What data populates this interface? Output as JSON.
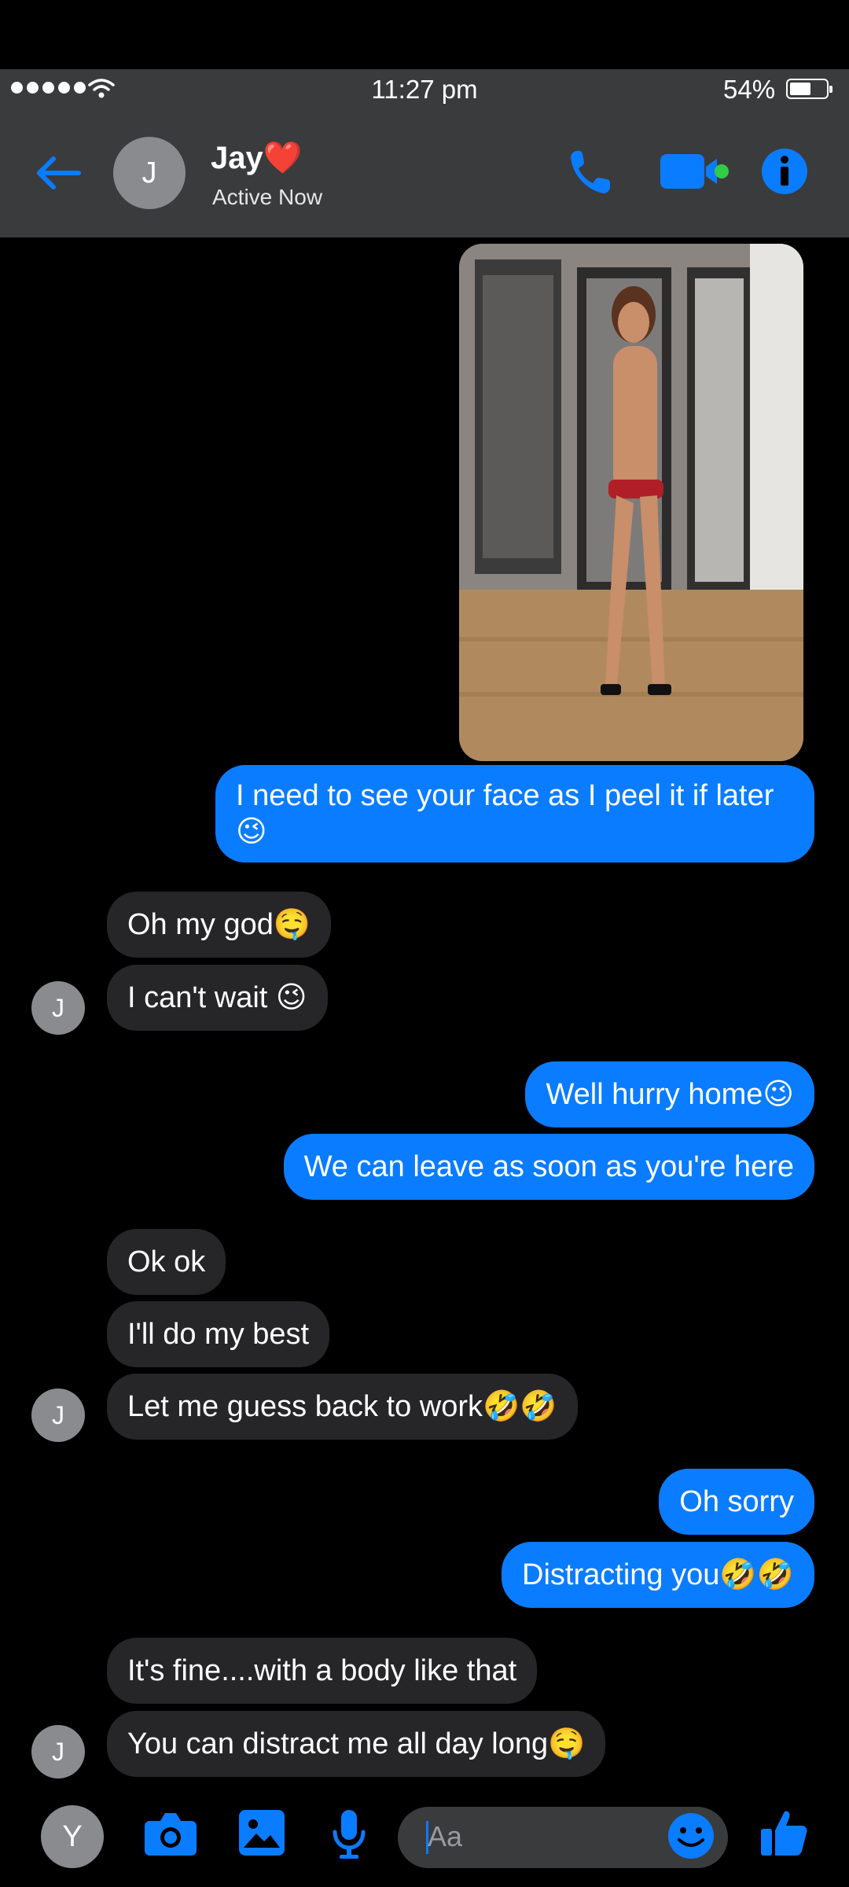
{
  "status_bar": {
    "time": "11:27 pm",
    "battery": "54%"
  },
  "header": {
    "avatar_initial": "J",
    "contact_name": "Jay",
    "contact_heart": "❤️",
    "contact_status": "Active Now"
  },
  "messages": [
    {
      "dir": "out",
      "text": "I need to see your face as I peel it if later",
      "text2": "😉"
    },
    {
      "dir": "in",
      "text": "Oh my god🤤"
    },
    {
      "dir": "in",
      "text": "I can't wait 😉"
    },
    {
      "dir": "out",
      "text": "Well hurry home😉"
    },
    {
      "dir": "out",
      "text": "We can leave as soon as you're here"
    },
    {
      "dir": "in",
      "text": "Ok ok"
    },
    {
      "dir": "in",
      "text": "I'll do my best"
    },
    {
      "dir": "in",
      "text": "Let me guess back to work🤣🤣"
    },
    {
      "dir": "out",
      "text": "Oh sorry"
    },
    {
      "dir": "out",
      "text": "Distracting you🤣🤣"
    },
    {
      "dir": "in",
      "text": "It's fine....with a body like that"
    },
    {
      "dir": "in",
      "text": "You can distract me all day long🤤"
    }
  ],
  "contact_avatar_initial": "J",
  "composer": {
    "self_avatar_initial": "Y",
    "input_placeholder": "Aa"
  },
  "colors": {
    "accent": "#0a7cff",
    "incoming_bubble": "#262628",
    "header_bg": "#3a3b3d"
  }
}
